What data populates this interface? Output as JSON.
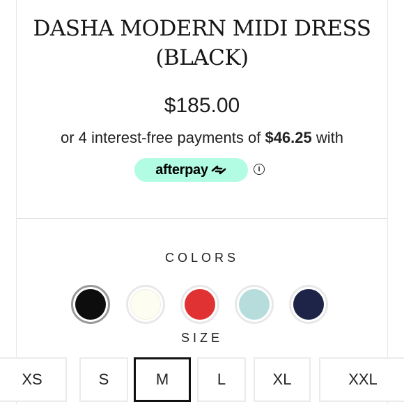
{
  "product": {
    "title_line1": "DASHA MODERN MIDI DRESS",
    "title_line2": "(BLACK)",
    "price": "$185.00",
    "installment_prefix": "or 4 interest-free payments of ",
    "installment_amount": "$46.25",
    "installment_suffix": " with",
    "afterpay_label": "afterpay",
    "info_label": "i"
  },
  "colors": {
    "label": "COLORS",
    "swatches": [
      {
        "name": "black",
        "hex": "#0d0d0d",
        "selected": true
      },
      {
        "name": "ivory",
        "hex": "#fdfdf2",
        "selected": false
      },
      {
        "name": "red",
        "hex": "#e03232",
        "selected": false
      },
      {
        "name": "mint",
        "hex": "#b7dcdc",
        "selected": false
      },
      {
        "name": "navy",
        "hex": "#1d2447",
        "selected": false
      }
    ]
  },
  "size": {
    "label": "SIZE",
    "options": [
      "XS",
      "S",
      "M",
      "L",
      "XL",
      "XXL"
    ],
    "selected": "M"
  },
  "theme": {
    "afterpay_mint": "#b2fce4",
    "selected_border": "#111111"
  }
}
